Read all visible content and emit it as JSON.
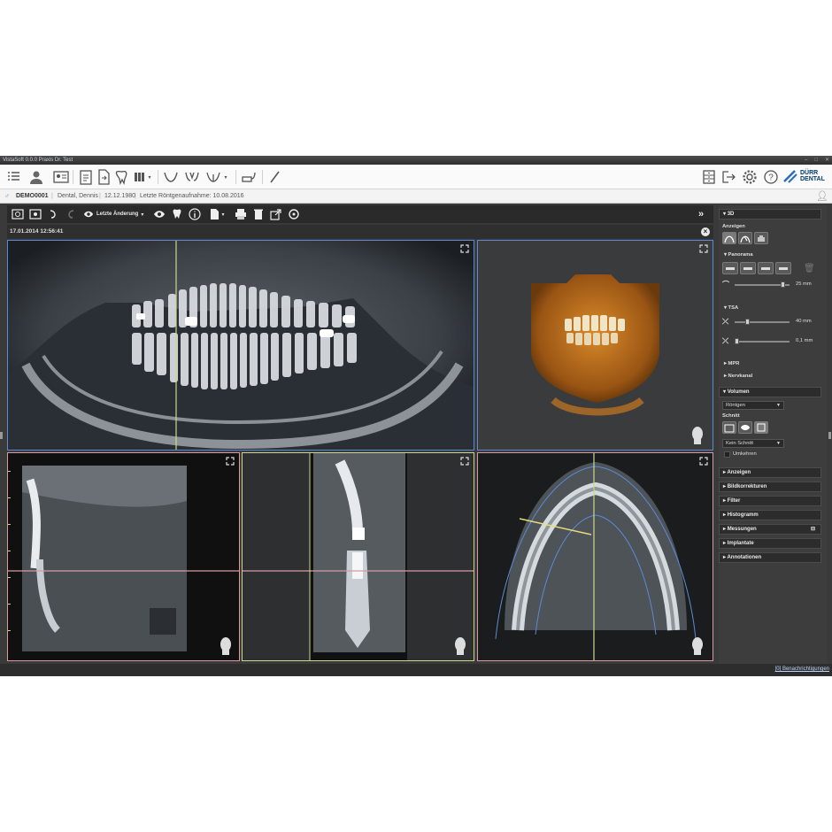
{
  "window": {
    "title": "VistaSoft 0.0.0 Praxis Dr. Test"
  },
  "patient": {
    "id": "DEMO0001",
    "name": "Dental, Dennis",
    "dob": "12.12.1980",
    "last_xray": "Letzte Röntgenaufnahme: 10.08.2016"
  },
  "image_toolbar": {
    "history_label": "Letzte Änderung"
  },
  "image": {
    "date": "17.01.2014 12:56:41"
  },
  "brand": {
    "line1": "DÜRR",
    "line2": "DENTAL"
  },
  "panel": {
    "section_3d": "3D",
    "anzeigen": "Anzeigen",
    "panorama": "Panorama",
    "pano_value": "25 mm",
    "tsa": "TSA",
    "tsa_val1": "40 mm",
    "tsa_val2": "0,1 mm",
    "mpr": "MPR",
    "nervkanal": "Nervkanal",
    "volumen": "Volumen",
    "volumen_select": "Röntgen",
    "schnitt": "Schnitt",
    "schnitt_select": "Kein Schnitt",
    "umkehren": "Umkehren",
    "sections": [
      "Anzeigen",
      "Bildkorrekturen",
      "Filter",
      "Histogramm",
      "Messungen",
      "Implantate",
      "Annotationen"
    ]
  },
  "status": {
    "notifications": "[0] Benachrichtigungen"
  },
  "colors": {
    "background": "#3a3a3a",
    "view_bg": "#000000",
    "accent_blue": "#5a8ad6",
    "line_green": "#c8d98a",
    "line_pink": "#d89aa0",
    "bone_orange": "#c87420"
  }
}
